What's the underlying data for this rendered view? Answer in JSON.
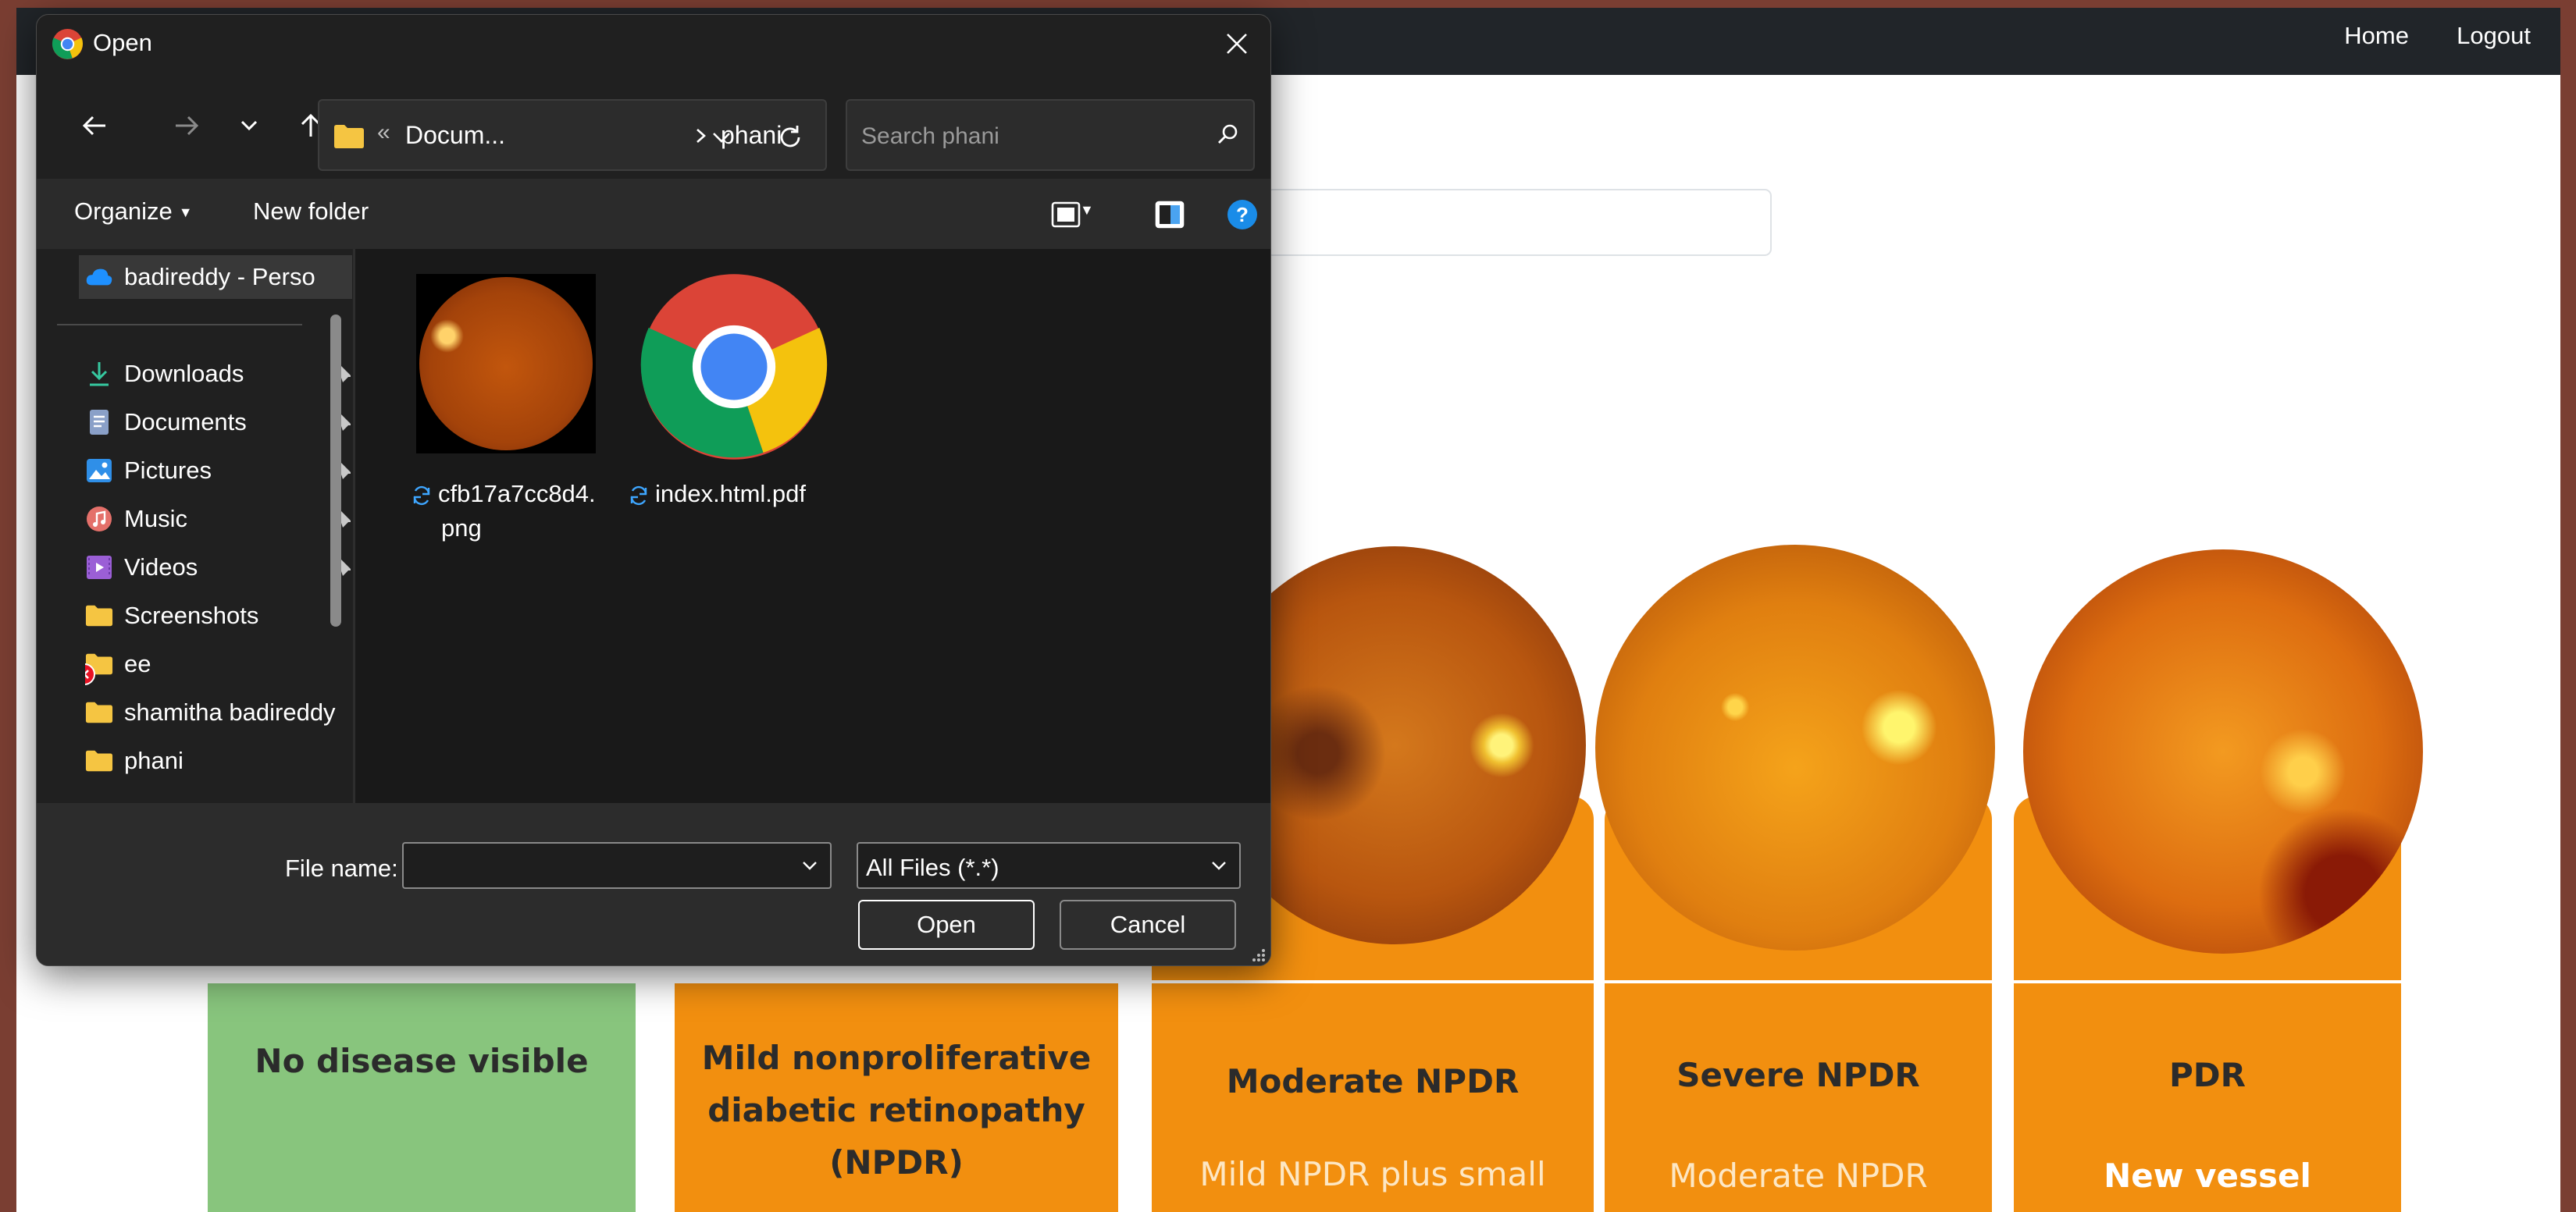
{
  "webpage": {
    "nav": {
      "home": "Home",
      "logout": "Logout"
    },
    "cards": [
      {
        "title": "No disease visible",
        "description": ""
      },
      {
        "title": "Mild nonproliferative diabetic retinopathy (NPDR)",
        "description": ""
      },
      {
        "title": "Moderate NPDR",
        "description": "Mild NPDR plus small"
      },
      {
        "title": "Severe NPDR",
        "description": "Moderate NPDR"
      },
      {
        "title": "PDR",
        "description": "New vessel"
      }
    ],
    "colors": {
      "navbar": "#212529",
      "card_orange": "#f28f0f",
      "card_green": "#88c57d"
    }
  },
  "dialog": {
    "title": "Open",
    "address": {
      "separator": "«",
      "crumbs": [
        "Docum...",
        "phani"
      ]
    },
    "search": {
      "placeholder": "Search phani"
    },
    "toolbar": {
      "organize": "Organize",
      "new_folder": "New folder"
    },
    "nav_pane": {
      "cloud": "badireddy - Perso",
      "quick_access": [
        {
          "label": "Downloads",
          "icon": "download-icon",
          "pinned": true
        },
        {
          "label": "Documents",
          "icon": "documents-icon",
          "pinned": true
        },
        {
          "label": "Pictures",
          "icon": "pictures-icon",
          "pinned": true
        },
        {
          "label": "Music",
          "icon": "music-icon",
          "pinned": true
        },
        {
          "label": "Videos",
          "icon": "videos-icon",
          "pinned": true
        },
        {
          "label": "Screenshots",
          "icon": "folder-icon",
          "pinned": false
        },
        {
          "label": "ee",
          "icon": "folder-error-icon",
          "pinned": false
        },
        {
          "label": "shamitha badireddy",
          "icon": "folder-icon",
          "pinned": false
        },
        {
          "label": "phani",
          "icon": "folder-icon",
          "pinned": false
        }
      ]
    },
    "files": [
      {
        "name_line1": "cfb17a7cc8d4.",
        "name_line2": "png",
        "thumb": "retina-thumbnail"
      },
      {
        "name_line1": "index.html.pdf",
        "name_line2": "",
        "thumb": "chrome-icon"
      }
    ],
    "footer": {
      "file_name_label": "File name:",
      "file_name_value": "",
      "file_type": "All Files (*.*)",
      "open": "Open",
      "cancel": "Cancel"
    },
    "colors": {
      "background": "#202020",
      "accent": "#0078d4",
      "folder": "#f5c542"
    }
  }
}
